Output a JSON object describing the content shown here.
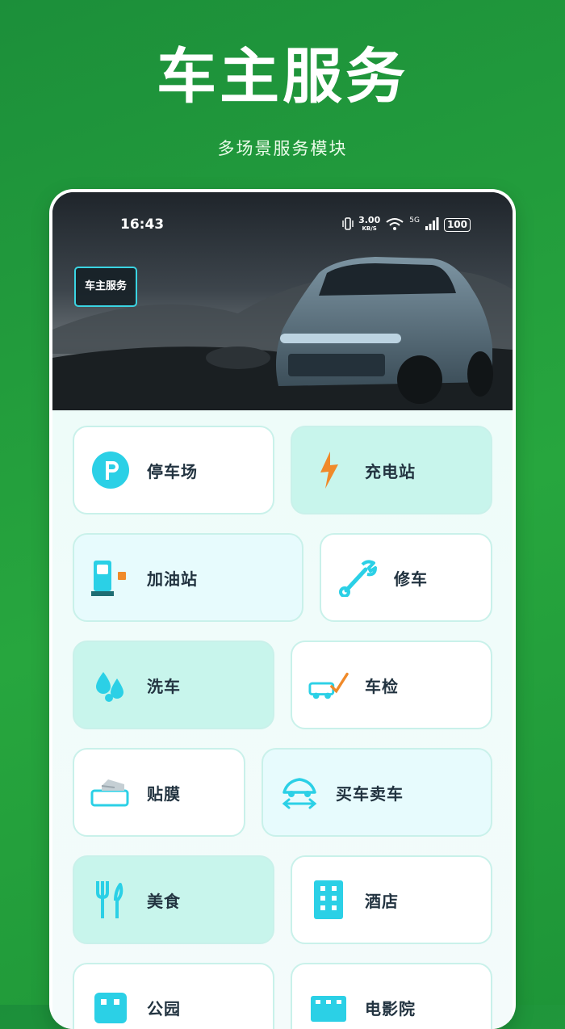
{
  "header": {
    "title": "车主服务",
    "subtitle": "多场景服务模块"
  },
  "statusbar": {
    "time": "16:43",
    "net_speed": "3.00",
    "net_unit": "KB/S",
    "signal_label": "5G",
    "battery": "100"
  },
  "banner": {
    "tag": "车主服务"
  },
  "colors": {
    "accent": "#2bd0e6",
    "orange": "#f08a2a",
    "background_green": "#27a63e"
  },
  "tiles": [
    {
      "label": "停车场",
      "icon": "parking-icon"
    },
    {
      "label": "充电站",
      "icon": "lightning-icon"
    },
    {
      "label": "加油站",
      "icon": "gas-pump-icon"
    },
    {
      "label": "修车",
      "icon": "wrench-icon"
    },
    {
      "label": "洗车",
      "icon": "water-drops-icon"
    },
    {
      "label": "车检",
      "icon": "car-check-icon"
    },
    {
      "label": "贴膜",
      "icon": "film-icon"
    },
    {
      "label": "买车卖车",
      "icon": "car-trade-icon"
    },
    {
      "label": "美食",
      "icon": "cutlery-icon"
    },
    {
      "label": "酒店",
      "icon": "hotel-icon"
    },
    {
      "label": "公园",
      "icon": "park-icon"
    },
    {
      "label": "电影院",
      "icon": "cinema-icon"
    }
  ]
}
